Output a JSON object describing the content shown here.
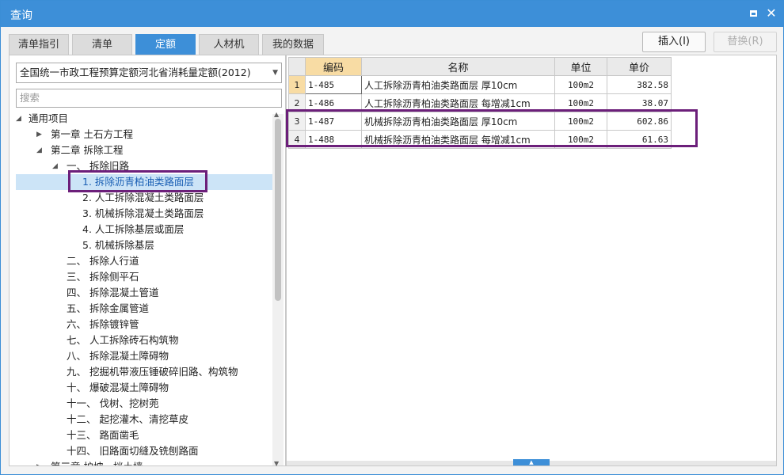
{
  "window": {
    "title": "查询",
    "maximize_icon": "maximize-icon",
    "close_icon": "close-icon"
  },
  "tabs": [
    {
      "label": "清单指引"
    },
    {
      "label": "清单"
    },
    {
      "label": "定额"
    },
    {
      "label": "人材机"
    },
    {
      "label": "我的数据"
    }
  ],
  "actions": {
    "insert": "插入(I)",
    "replace": "替换(R)"
  },
  "left": {
    "quota_library": "全国统一市政工程预算定额河北省消耗量定额(2012)",
    "search_placeholder": "搜索",
    "tree": [
      {
        "label": "通用项目",
        "toggle": "◢"
      },
      {
        "label": "第一章 土石方工程",
        "toggle": "▶"
      },
      {
        "label": "第二章 拆除工程",
        "toggle": "◢"
      },
      {
        "label": "一、 拆除旧路",
        "toggle": "◢"
      },
      {
        "label": "1. 拆除沥青柏油类路面层",
        "toggle": ""
      },
      {
        "label": "2. 人工拆除混凝土类路面层",
        "toggle": ""
      },
      {
        "label": "3. 机械拆除混凝土类路面层",
        "toggle": ""
      },
      {
        "label": "4. 人工拆除基层或面层",
        "toggle": ""
      },
      {
        "label": "5. 机械拆除基层",
        "toggle": ""
      },
      {
        "label": "二、 拆除人行道",
        "toggle": ""
      },
      {
        "label": "三、 拆除侧平石",
        "toggle": ""
      },
      {
        "label": "四、 拆除混凝土管道",
        "toggle": ""
      },
      {
        "label": "五、 拆除金属管道",
        "toggle": ""
      },
      {
        "label": "六、 拆除镀锌管",
        "toggle": ""
      },
      {
        "label": "七、 人工拆除砖石构筑物",
        "toggle": ""
      },
      {
        "label": "八、 拆除混凝土障碍物",
        "toggle": ""
      },
      {
        "label": "九、 挖掘机带液压锤破碎旧路、构筑物",
        "toggle": ""
      },
      {
        "label": "十、 爆破混凝土障碍物",
        "toggle": ""
      },
      {
        "label": "十一、 伐树、挖树蔸",
        "toggle": ""
      },
      {
        "label": "十二、 起挖灌木、清挖草皮",
        "toggle": ""
      },
      {
        "label": "十三、 路面凿毛",
        "toggle": ""
      },
      {
        "label": "十四、 旧路面切缝及铣刨路面",
        "toggle": ""
      },
      {
        "label": "第三章 护坡、挡土墙",
        "toggle": "▶"
      }
    ]
  },
  "grid": {
    "headers": {
      "code": "编码",
      "name": "名称",
      "unit": "单位",
      "price": "单价"
    },
    "rows": [
      {
        "num": "1",
        "code": "1-485",
        "name": "人工拆除沥青柏油类路面层 厚10cm",
        "unit": "100m2",
        "price": "382.58"
      },
      {
        "num": "2",
        "code": "1-486",
        "name": "人工拆除沥青柏油类路面层 每增减1cm",
        "unit": "100m2",
        "price": "38.07"
      },
      {
        "num": "3",
        "code": "1-487",
        "name": "机械拆除沥青柏油类路面层 厚10cm",
        "unit": "100m2",
        "price": "602.86"
      },
      {
        "num": "4",
        "code": "1-488",
        "name": "机械拆除沥青柏油类路面层 每增减1cm",
        "unit": "100m2",
        "price": "61.63"
      }
    ]
  },
  "colors": {
    "accent": "#3d8fd8",
    "highlight_box": "#6c1f7a",
    "selected_row": "#cce4f7",
    "active_header": "#f8dca4"
  }
}
